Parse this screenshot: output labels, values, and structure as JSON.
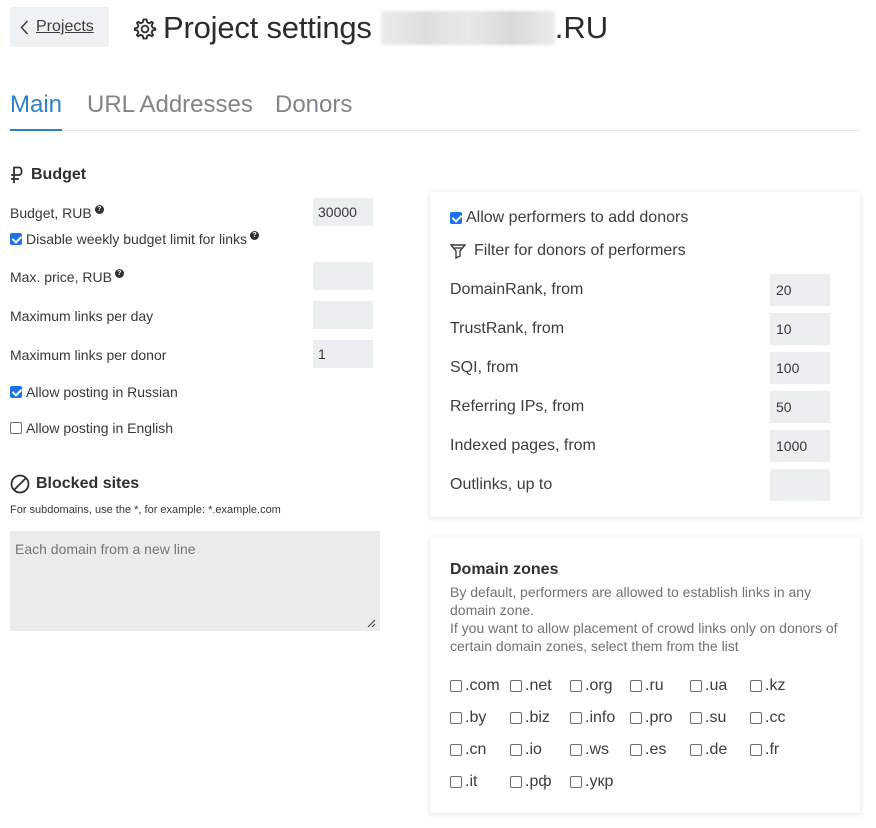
{
  "header": {
    "back_label": "Projects",
    "title": "Project settings",
    "domain_suffix": ".RU"
  },
  "tabs": [
    {
      "label": "Main",
      "active": true
    },
    {
      "label": "URL Addresses",
      "active": false
    },
    {
      "label": "Donors",
      "active": false
    }
  ],
  "budget": {
    "title": "Budget",
    "budget_label": "Budget, RUB",
    "budget_value": "30000",
    "disable_weekly_label": "Disable weekly budget limit for links",
    "disable_weekly_checked": true,
    "max_price_label": "Max. price, RUB",
    "max_price_value": "",
    "max_links_day_label": "Maximum links per day",
    "max_links_day_value": "",
    "max_links_donor_label": "Maximum links per donor",
    "max_links_donor_value": "1",
    "allow_russian_label": "Allow posting in Russian",
    "allow_russian_checked": true,
    "allow_english_label": "Allow posting in English",
    "allow_english_checked": false
  },
  "blocked": {
    "title": "Blocked sites",
    "hint": "For subdomains, use the *, for example: *.example.com",
    "placeholder": "Each domain from a new line"
  },
  "donors_filter": {
    "allow_add_label": "Allow performers to add donors",
    "allow_add_checked": true,
    "filter_title": "Filter for donors of performers",
    "rows": [
      {
        "label": "DomainRank, from",
        "value": "20"
      },
      {
        "label": "TrustRank, from",
        "value": "10"
      },
      {
        "label": "SQI, from",
        "value": "100"
      },
      {
        "label": "Referring IPs, from",
        "value": "50"
      },
      {
        "label": "Indexed pages, from",
        "value": "1000"
      },
      {
        "label": "Outlinks, up to",
        "value": ""
      }
    ]
  },
  "domain_zones": {
    "title": "Domain zones",
    "desc_line1": "By default, performers are allowed to establish links in any domain zone.",
    "desc_line2": "If you want to allow placement of crowd links only on donors of certain domain zones, select them from the list",
    "zones": [
      ".com",
      ".net",
      ".org",
      ".ru",
      ".ua",
      ".kz",
      ".by",
      ".biz",
      ".info",
      ".pro",
      ".su",
      ".cc",
      ".cn",
      ".io",
      ".ws",
      ".es",
      ".de",
      ".fr",
      ".it",
      ".рф",
      ".укр"
    ]
  },
  "colors": {
    "accent": "#2d82c4",
    "checkbox": "#1a73e8",
    "field_bg": "#eceff0"
  }
}
